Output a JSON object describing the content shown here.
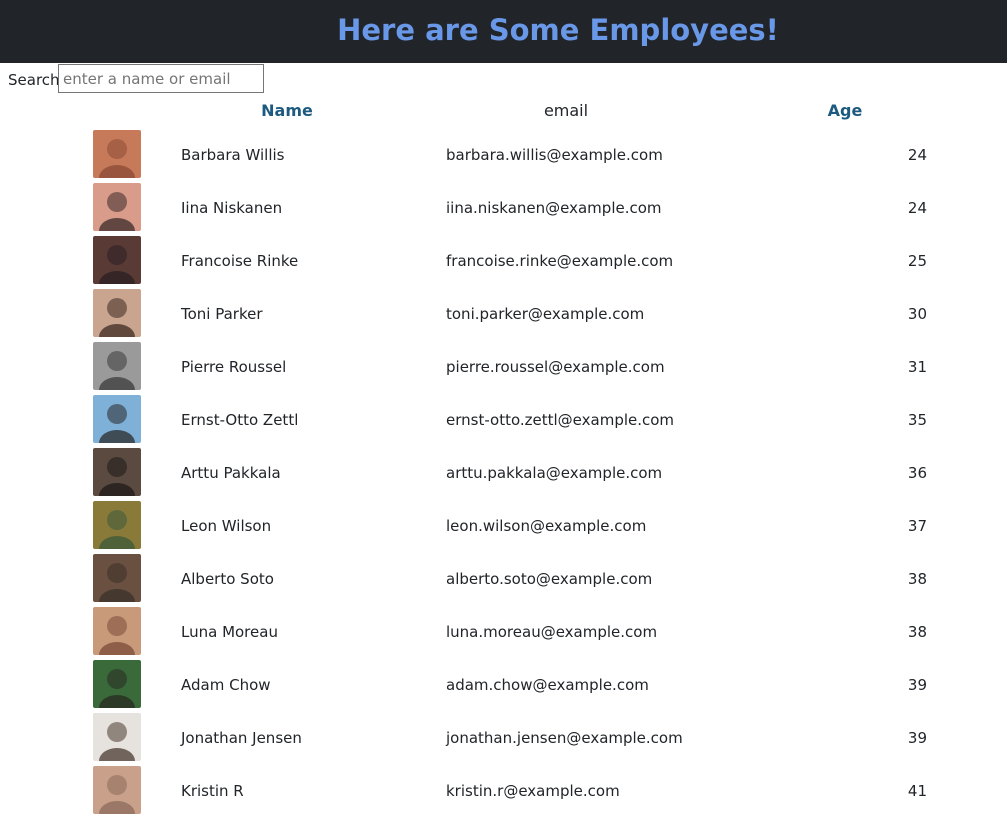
{
  "header": {
    "title": "Here are Some Employees!"
  },
  "search": {
    "label": "Search:",
    "placeholder": "enter a name or email",
    "value": ""
  },
  "columns": {
    "name": "Name",
    "email": "email",
    "age": "Age"
  },
  "employees": [
    {
      "name": "Barbara Willis",
      "email": "barbara.willis@example.com",
      "age": "24",
      "avatar_colors": [
        "#c77a5a",
        "#8a4a35"
      ]
    },
    {
      "name": "Iina Niskanen",
      "email": "iina.niskanen@example.com",
      "age": "24",
      "avatar_colors": [
        "#d99c8a",
        "#3a2a2a"
      ]
    },
    {
      "name": "Francoise Rinke",
      "email": "francoise.rinke@example.com",
      "age": "25",
      "avatar_colors": [
        "#5a3a35",
        "#2a1f22"
      ]
    },
    {
      "name": "Toni Parker",
      "email": "toni.parker@example.com",
      "age": "30",
      "avatar_colors": [
        "#c9a48f",
        "#3c2a22"
      ]
    },
    {
      "name": "Pierre Roussel",
      "email": "pierre.roussel@example.com",
      "age": "31",
      "avatar_colors": [
        "#9a9a9a",
        "#3a3a3a"
      ]
    },
    {
      "name": "Ernst-Otto Zettl",
      "email": "ernst-otto.zettl@example.com",
      "age": "35",
      "avatar_colors": [
        "#7fb0d8",
        "#2a2a2a"
      ]
    },
    {
      "name": "Arttu Pakkala",
      "email": "arttu.pakkala@example.com",
      "age": "36",
      "avatar_colors": [
        "#5a4a40",
        "#1f1a18"
      ]
    },
    {
      "name": "Leon Wilson",
      "email": "leon.wilson@example.com",
      "age": "37",
      "avatar_colors": [
        "#8a7a3a",
        "#3a5a3a"
      ]
    },
    {
      "name": "Alberto Soto",
      "email": "alberto.soto@example.com",
      "age": "38",
      "avatar_colors": [
        "#6a5040",
        "#3a3028"
      ]
    },
    {
      "name": "Luna Moreau",
      "email": "luna.moreau@example.com",
      "age": "38",
      "avatar_colors": [
        "#c99a7a",
        "#7a4a3a"
      ]
    },
    {
      "name": "Adam Chow",
      "email": "adam.chow@example.com",
      "age": "39",
      "avatar_colors": [
        "#3a6a3a",
        "#2a2a22"
      ]
    },
    {
      "name": "Jonathan Jensen",
      "email": "jonathan.jensen@example.com",
      "age": "39",
      "avatar_colors": [
        "#e6e2de",
        "#4a3a30"
      ]
    },
    {
      "name": "Kristin R",
      "email": "kristin.r@example.com",
      "age": "41",
      "avatar_colors": [
        "#c9a08a",
        "#8a6a5a"
      ]
    }
  ]
}
